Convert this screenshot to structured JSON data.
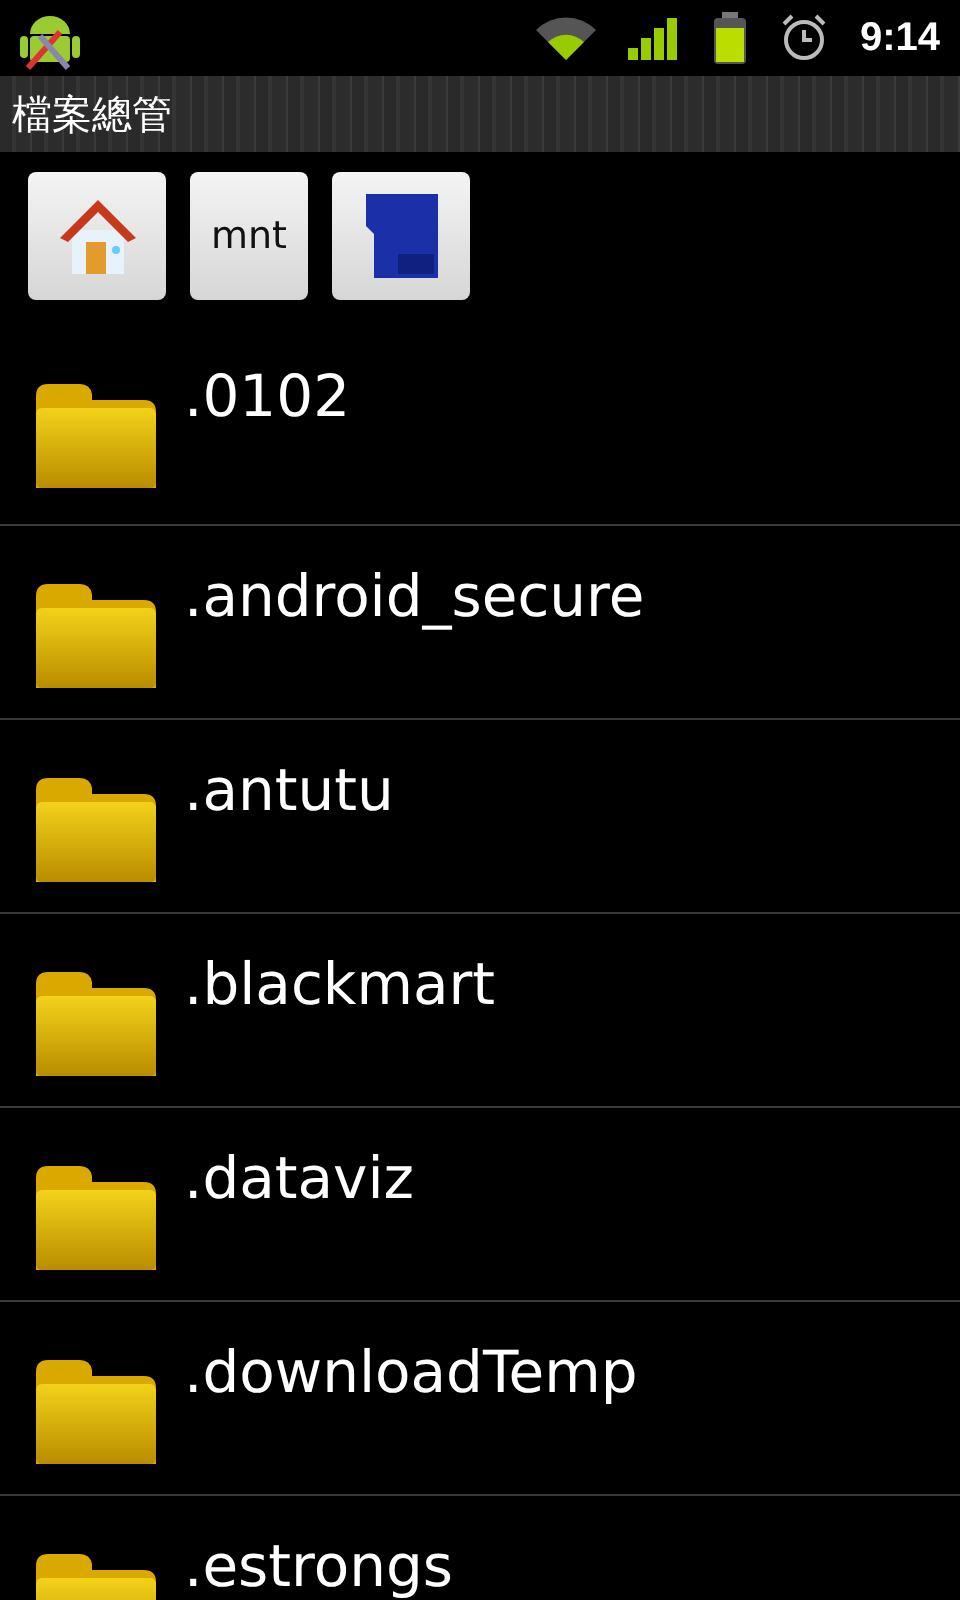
{
  "status_bar": {
    "time": "9:14"
  },
  "title_bar": {
    "title": "檔案總管"
  },
  "path_buttons": [
    {
      "kind": "home"
    },
    {
      "kind": "text",
      "label": "mnt"
    },
    {
      "kind": "sd"
    }
  ],
  "folders": [
    {
      "name": ".0102"
    },
    {
      "name": ".android_secure"
    },
    {
      "name": ".antutu"
    },
    {
      "name": ".blackmart"
    },
    {
      "name": ".dataviz"
    },
    {
      "name": ".downloadTemp"
    },
    {
      "name": ".estrongs"
    }
  ]
}
